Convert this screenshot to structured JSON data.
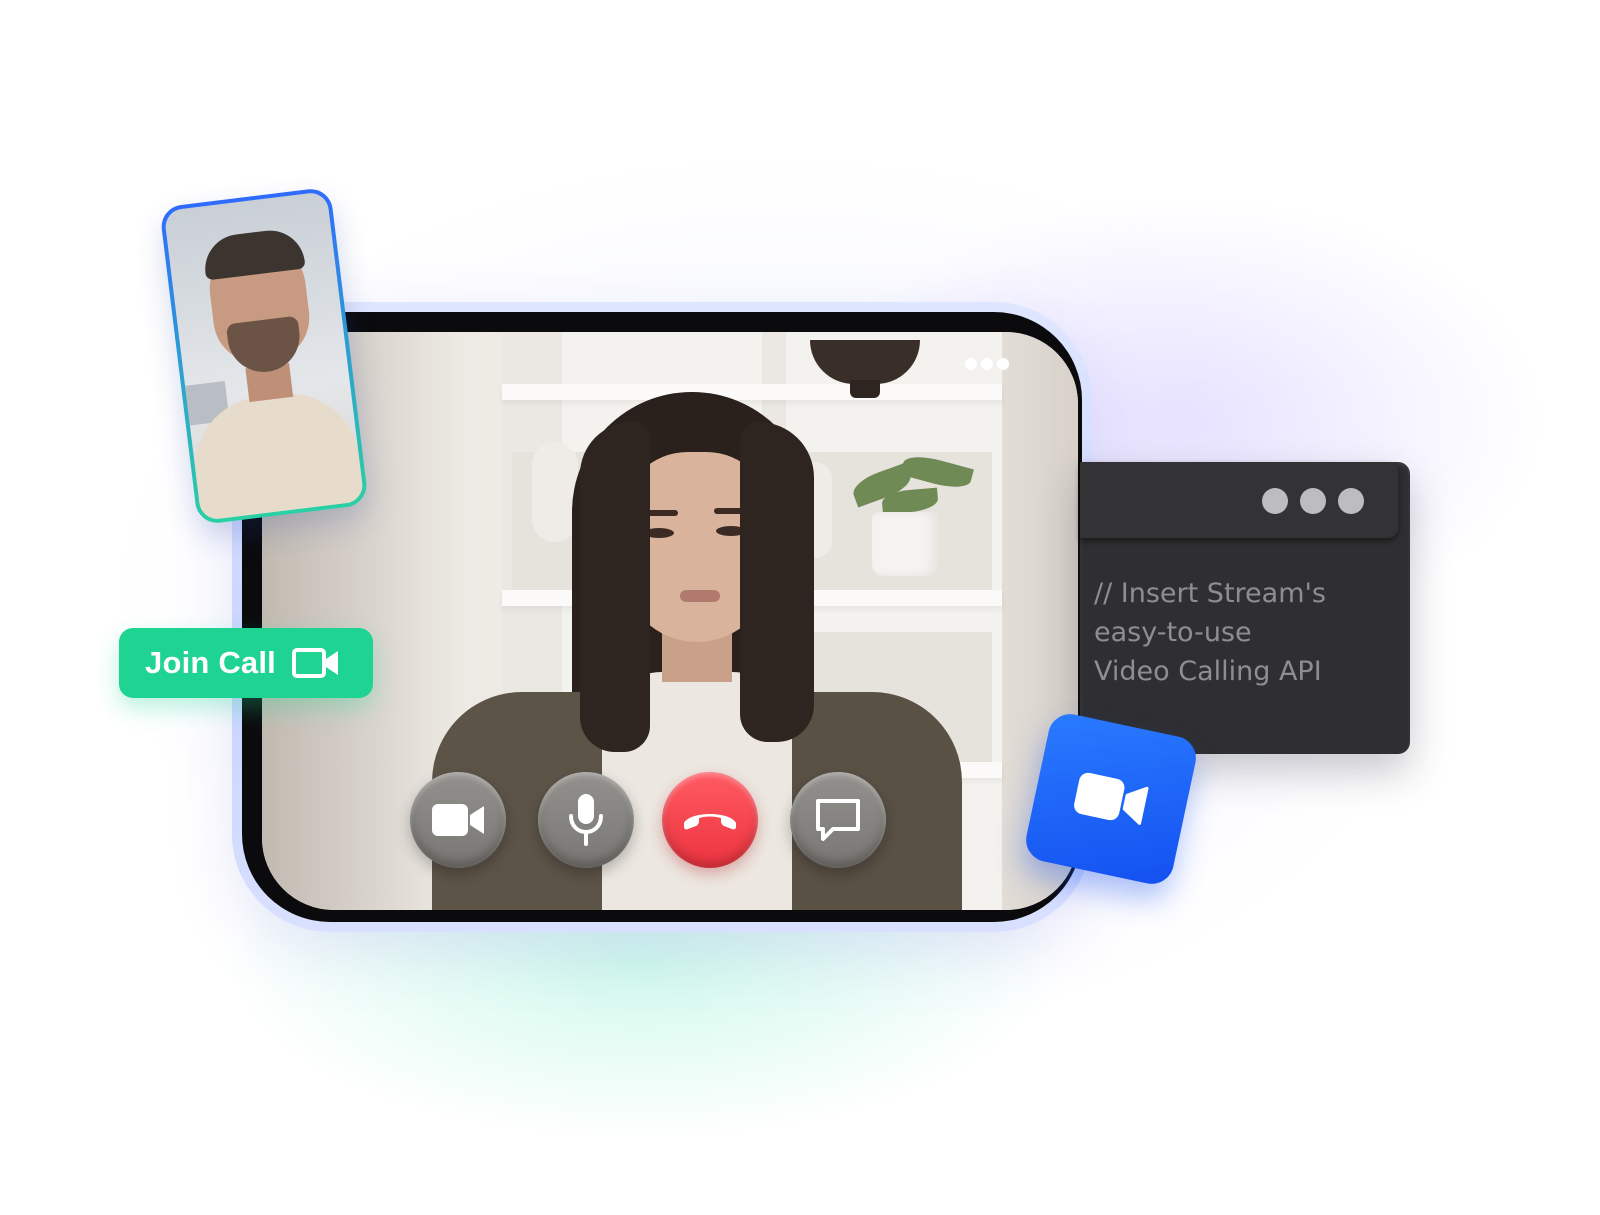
{
  "main_call": {
    "more_icon": "ellipsis-icon",
    "controls": [
      {
        "name": "video-toggle",
        "icon": "video-camera-icon"
      },
      {
        "name": "mic-toggle",
        "icon": "microphone-icon"
      },
      {
        "name": "end-call",
        "icon": "phone-hangup-icon"
      },
      {
        "name": "chat",
        "icon": "chat-bubble-icon"
      }
    ]
  },
  "join_call": {
    "label": "Join Call",
    "icon": "video-camera-icon"
  },
  "code_window": {
    "text": "// Insert Stream's\neasy-to-use\nVideo Calling API"
  },
  "colors": {
    "join_green": "#1fd492",
    "end_call_red": "#ec3440",
    "accent_blue": "#1350f0",
    "control_gray": "#797773",
    "code_bg": "#2f2f31"
  }
}
